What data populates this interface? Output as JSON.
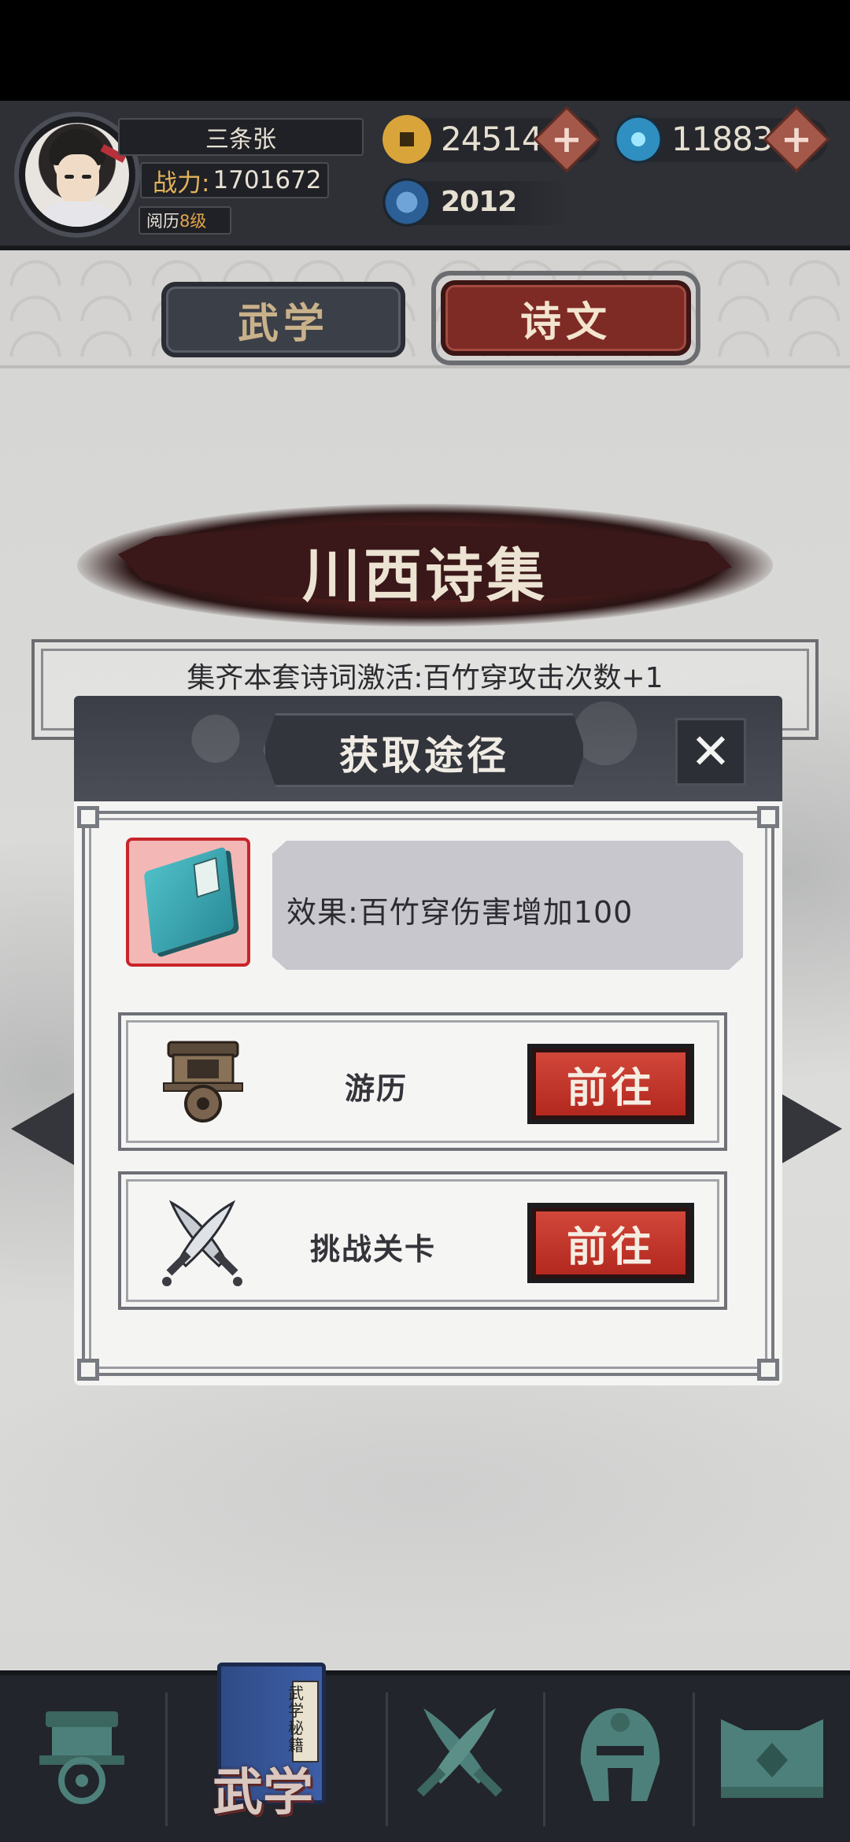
{
  "player": {
    "name": "三条张",
    "power_label": "战力:",
    "power_value": "1701672",
    "level_label": "阅历",
    "level_value": "8级"
  },
  "resources": {
    "gold": "24514",
    "crystal": "11883",
    "jade": "2012"
  },
  "tabs": [
    {
      "label": "武学",
      "selected": false
    },
    {
      "label": "诗文",
      "selected": true
    }
  ],
  "set": {
    "title": "川西诗集",
    "bonus": "集齐本套诗词激活:百竹穿攻击次数+1"
  },
  "modal": {
    "title": "获取途径",
    "close_label": "✕",
    "effect": "效果:百竹穿伤害增加100",
    "routes": [
      {
        "label": "游历",
        "button": "前往",
        "icon": "cart-icon"
      },
      {
        "label": "挑战关卡",
        "button": "前往",
        "icon": "crossed-swords-icon"
      }
    ]
  },
  "bottom_nav": {
    "active_label": "武学",
    "book_tag": "武学秘籍",
    "items": [
      "cart-nav-icon",
      "martial-book-nav-icon",
      "crossed-swords-nav-icon",
      "helmet-nav-icon",
      "armor-nav-icon"
    ]
  },
  "colors": {
    "accent_red": "#b3281f",
    "tab_selected": "#7e2a25",
    "header_bg": "#2e3036"
  }
}
